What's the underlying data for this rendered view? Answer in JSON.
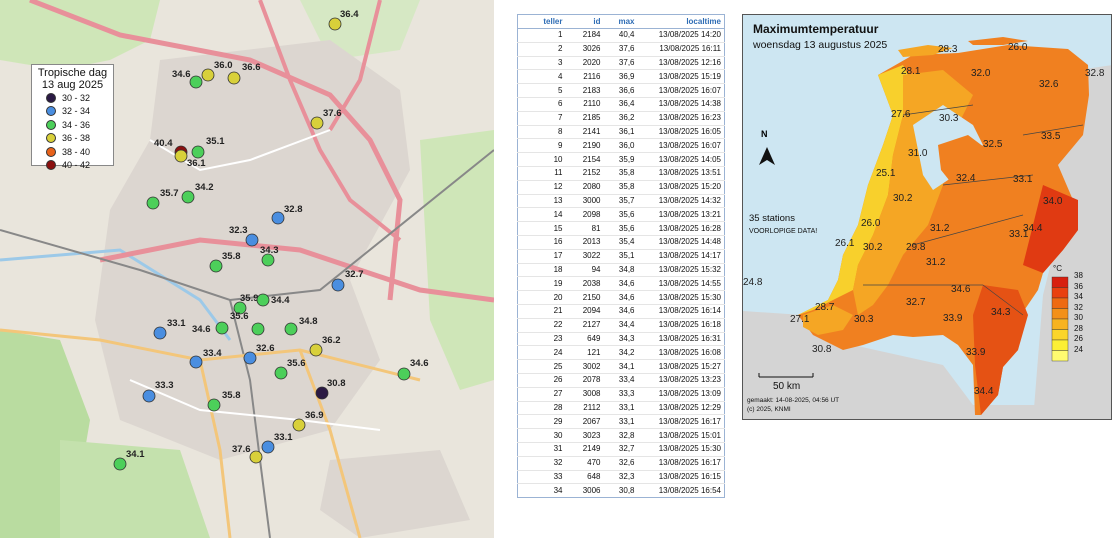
{
  "left_map": {
    "legend": {
      "title_line1": "Tropische dag",
      "title_line2": "13 aug 2025",
      "items": [
        {
          "label": "30 - 32",
          "color": "#2b1a44"
        },
        {
          "label": "32 - 34",
          "color": "#4a8ee0"
        },
        {
          "label": "34 - 36",
          "color": "#4ccf5a"
        },
        {
          "label": "36 - 38",
          "color": "#d8d03a"
        },
        {
          "label": "38 - 40",
          "color": "#e8621a"
        },
        {
          "label": "40 - 42",
          "color": "#8a1010"
        }
      ]
    },
    "stations": [
      "36.4",
      "36.0",
      "36.6",
      "34.6",
      "37.6",
      "40.4",
      "35.1",
      "36.1",
      "35.7",
      "34.2",
      "32.8",
      "32.3",
      "34.3",
      "35.8",
      "32.7",
      "35.9",
      "34.4",
      "35.6",
      "34.8",
      "33.1",
      "34.6",
      "36.2",
      "33.4",
      "32.6",
      "35.6",
      "30.8",
      "33.3",
      "35.8",
      "34.6",
      "36.9",
      "33.1",
      "37.6",
      "34.1"
    ]
  },
  "table": {
    "headers": [
      "teller",
      "id",
      "max",
      "localtime"
    ],
    "rows": [
      [
        "1",
        "2184",
        "40,4",
        "13/08/2025 14:20"
      ],
      [
        "2",
        "3026",
        "37,6",
        "13/08/2025 16:11"
      ],
      [
        "3",
        "2020",
        "37,6",
        "13/08/2025 12:16"
      ],
      [
        "4",
        "2116",
        "36,9",
        "13/08/2025 15:19"
      ],
      [
        "5",
        "2183",
        "36,6",
        "13/08/2025 16:07"
      ],
      [
        "6",
        "2110",
        "36,4",
        "13/08/2025 14:38"
      ],
      [
        "7",
        "2185",
        "36,2",
        "13/08/2025 16:23"
      ],
      [
        "8",
        "2141",
        "36,1",
        "13/08/2025 16:05"
      ],
      [
        "9",
        "2190",
        "36,0",
        "13/08/2025 16:07"
      ],
      [
        "10",
        "2154",
        "35,9",
        "13/08/2025 14:05"
      ],
      [
        "11",
        "2152",
        "35,8",
        "13/08/2025 13:51"
      ],
      [
        "12",
        "2080",
        "35,8",
        "13/08/2025 15:20"
      ],
      [
        "13",
        "3000",
        "35,7",
        "13/08/2025 14:32"
      ],
      [
        "14",
        "2098",
        "35,6",
        "13/08/2025 13:21"
      ],
      [
        "15",
        "81",
        "35,6",
        "13/08/2025 16:28"
      ],
      [
        "16",
        "2013",
        "35,4",
        "13/08/2025 14:48"
      ],
      [
        "17",
        "3022",
        "35,1",
        "13/08/2025 14:17"
      ],
      [
        "18",
        "94",
        "34,8",
        "13/08/2025 15:32"
      ],
      [
        "19",
        "2038",
        "34,6",
        "13/08/2025 14:55"
      ],
      [
        "20",
        "2150",
        "34,6",
        "13/08/2025 15:30"
      ],
      [
        "21",
        "2094",
        "34,6",
        "13/08/2025 16:14"
      ],
      [
        "22",
        "2127",
        "34,4",
        "13/08/2025 16:18"
      ],
      [
        "23",
        "649",
        "34,3",
        "13/08/2025 16:31"
      ],
      [
        "24",
        "121",
        "34,2",
        "13/08/2025 16:08"
      ],
      [
        "25",
        "3002",
        "34,1",
        "13/08/2025 15:27"
      ],
      [
        "26",
        "2078",
        "33,4",
        "13/08/2025 13:23"
      ],
      [
        "27",
        "3008",
        "33,3",
        "13/08/2025 13:09"
      ],
      [
        "28",
        "2112",
        "33,1",
        "13/08/2025 12:29"
      ],
      [
        "29",
        "2067",
        "33,1",
        "13/08/2025 16:17"
      ],
      [
        "30",
        "3023",
        "32,8",
        "13/08/2025 15:01"
      ],
      [
        "31",
        "2149",
        "32,7",
        "13/08/2025 15:30"
      ],
      [
        "32",
        "470",
        "32,6",
        "13/08/2025 16:17"
      ],
      [
        "33",
        "648",
        "32,3",
        "13/08/2025 16:15"
      ],
      [
        "34",
        "3006",
        "30,8",
        "13/08/2025 16:54"
      ]
    ]
  },
  "knmi": {
    "title": "Maximumtemperatuur",
    "subtitle": "woensdag 13 augustus 2025",
    "stations_note": "35 stations",
    "prelim_note": "VOORLOPIGE DATA!",
    "scale_label": "50 km",
    "made_label": "gemaakt: 14-08-2025, 04:56 UT",
    "copyright": "(c) 2025, KNMI",
    "north": "N",
    "unit": "°C",
    "colorbar_labels": [
      "38",
      "36",
      "34",
      "32",
      "30",
      "28",
      "26",
      "24"
    ],
    "colorbar_colors": [
      "#d71f0f",
      "#e94010",
      "#ee6a12",
      "#f39018",
      "#f7b320",
      "#fbd52a",
      "#fcef34",
      "#fffb70"
    ],
    "values": [
      "28.3",
      "26.0",
      "28.1",
      "32.0",
      "32.8",
      "32.6",
      "27.6",
      "30.3",
      "33.5",
      "32.5",
      "31.0",
      "25.1",
      "32.4",
      "33.1",
      "30.2",
      "34.0",
      "26.0",
      "31.2",
      "33.1",
      "34.4",
      "26.1",
      "30.2",
      "29.8",
      "31.2",
      "24.8",
      "34.6",
      "32.7",
      "28.7",
      "34.3",
      "27.1",
      "30.3",
      "33.9",
      "30.8",
      "33.9",
      "34.4"
    ]
  }
}
